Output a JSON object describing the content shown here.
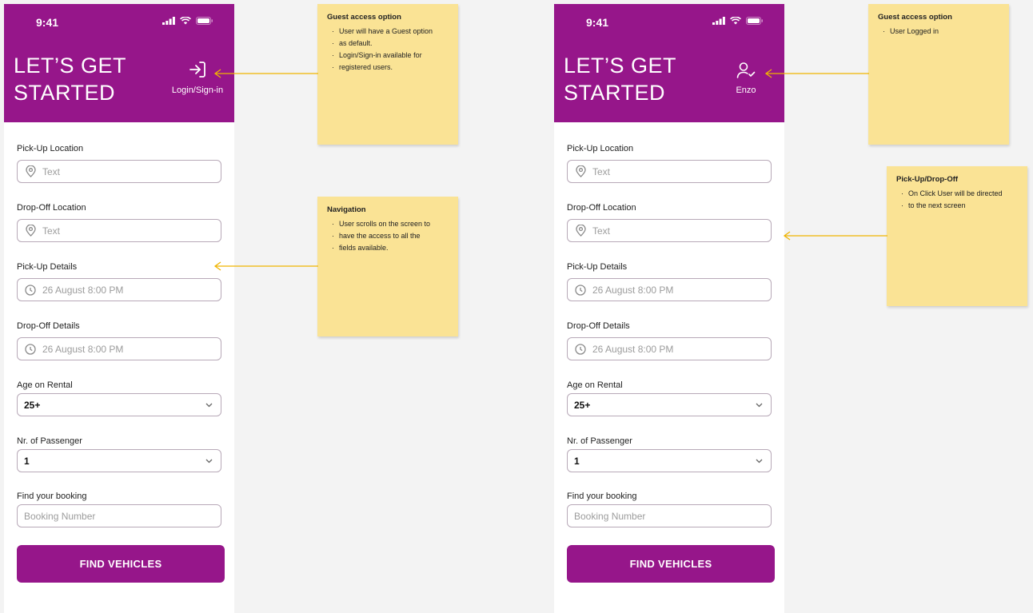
{
  "screens": [
    {
      "time": "9:41",
      "title_line1": "LET’S GET",
      "title_line2": "STARTED",
      "account_icon": "login-icon",
      "account_label": "Login/Sign-in",
      "pickup_location": {
        "label": "Pick-Up Location",
        "placeholder": "Text"
      },
      "dropoff_location": {
        "label": "Drop-Off Location",
        "placeholder": "Text"
      },
      "pickup_details": {
        "label": "Pick-Up Details",
        "placeholder": "26 August 8:00 PM"
      },
      "dropoff_details": {
        "label": "Drop-Off Details",
        "placeholder": "26 August 8:00 PM"
      },
      "age": {
        "label": "Age on Rental",
        "value": "25+"
      },
      "passengers": {
        "label": "Nr. of Passenger",
        "value": "1"
      },
      "booking": {
        "label": "Find your booking",
        "placeholder": "Booking Number"
      },
      "button": "FIND VEHICLES"
    },
    {
      "time": "9:41",
      "title_line1": "LET’S GET",
      "title_line2": "STARTED",
      "account_icon": "user-check-icon",
      "account_label": "Enzo",
      "pickup_location": {
        "label": "Pick-Up Location",
        "placeholder": "Text"
      },
      "dropoff_location": {
        "label": "Drop-Off Location",
        "placeholder": "Text"
      },
      "pickup_details": {
        "label": "Pick-Up Details",
        "placeholder": "26 August 8:00 PM"
      },
      "dropoff_details": {
        "label": "Drop-Off Details",
        "placeholder": "26 August 8:00 PM"
      },
      "age": {
        "label": "Age on Rental",
        "value": "25+"
      },
      "passengers": {
        "label": "Nr. of Passenger",
        "value": "1"
      },
      "booking": {
        "label": "Find your booking",
        "placeholder": "Booking Number"
      },
      "button": "FIND VEHICLES"
    }
  ],
  "notes": {
    "guest_1": {
      "title": "Guest access option",
      "items": [
        "User will have a Guest option",
        "as default.",
        "Login/Sign-in available for",
        "registered users."
      ]
    },
    "navigation": {
      "title": "Navigation",
      "items": [
        "User scrolls on the screen to",
        "have the access to all the",
        "fields available."
      ]
    },
    "guest_2": {
      "title": "Guest access option",
      "items": [
        "User  Logged in"
      ]
    },
    "pickup_dropoff": {
      "title": "Pick-Up/Drop-Off",
      "items": [
        "On Click User will be directed",
        "to the next screen"
      ]
    }
  },
  "colors": {
    "brand": "#96168a",
    "note": "#fae395",
    "arrow": "#f0b400"
  }
}
